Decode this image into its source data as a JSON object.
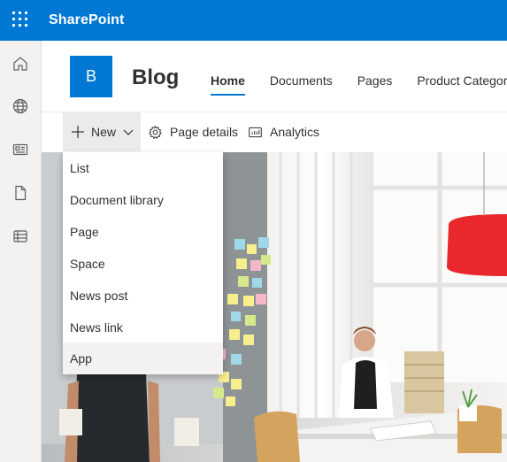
{
  "suite": {
    "title": "SharePoint",
    "waffle_icon": "app-launcher-icon"
  },
  "appbar": {
    "icons": [
      "home-icon",
      "globe-icon",
      "news-icon",
      "file-icon",
      "lists-icon"
    ]
  },
  "site": {
    "logo_letter": "B",
    "title": "Blog",
    "nav": [
      "Home",
      "Documents",
      "Pages",
      "Product Category"
    ],
    "active_nav": "Home"
  },
  "commandbar": {
    "new_label": "New",
    "page_details_label": "Page details",
    "analytics_label": "Analytics"
  },
  "new_menu": {
    "items": [
      "List",
      "Document library",
      "Page",
      "Space",
      "News post",
      "News link",
      "App"
    ],
    "highlighted": "App"
  },
  "colors": {
    "brand": "#0078d4",
    "text": "#323130",
    "appbar": "#f3f2f1"
  }
}
